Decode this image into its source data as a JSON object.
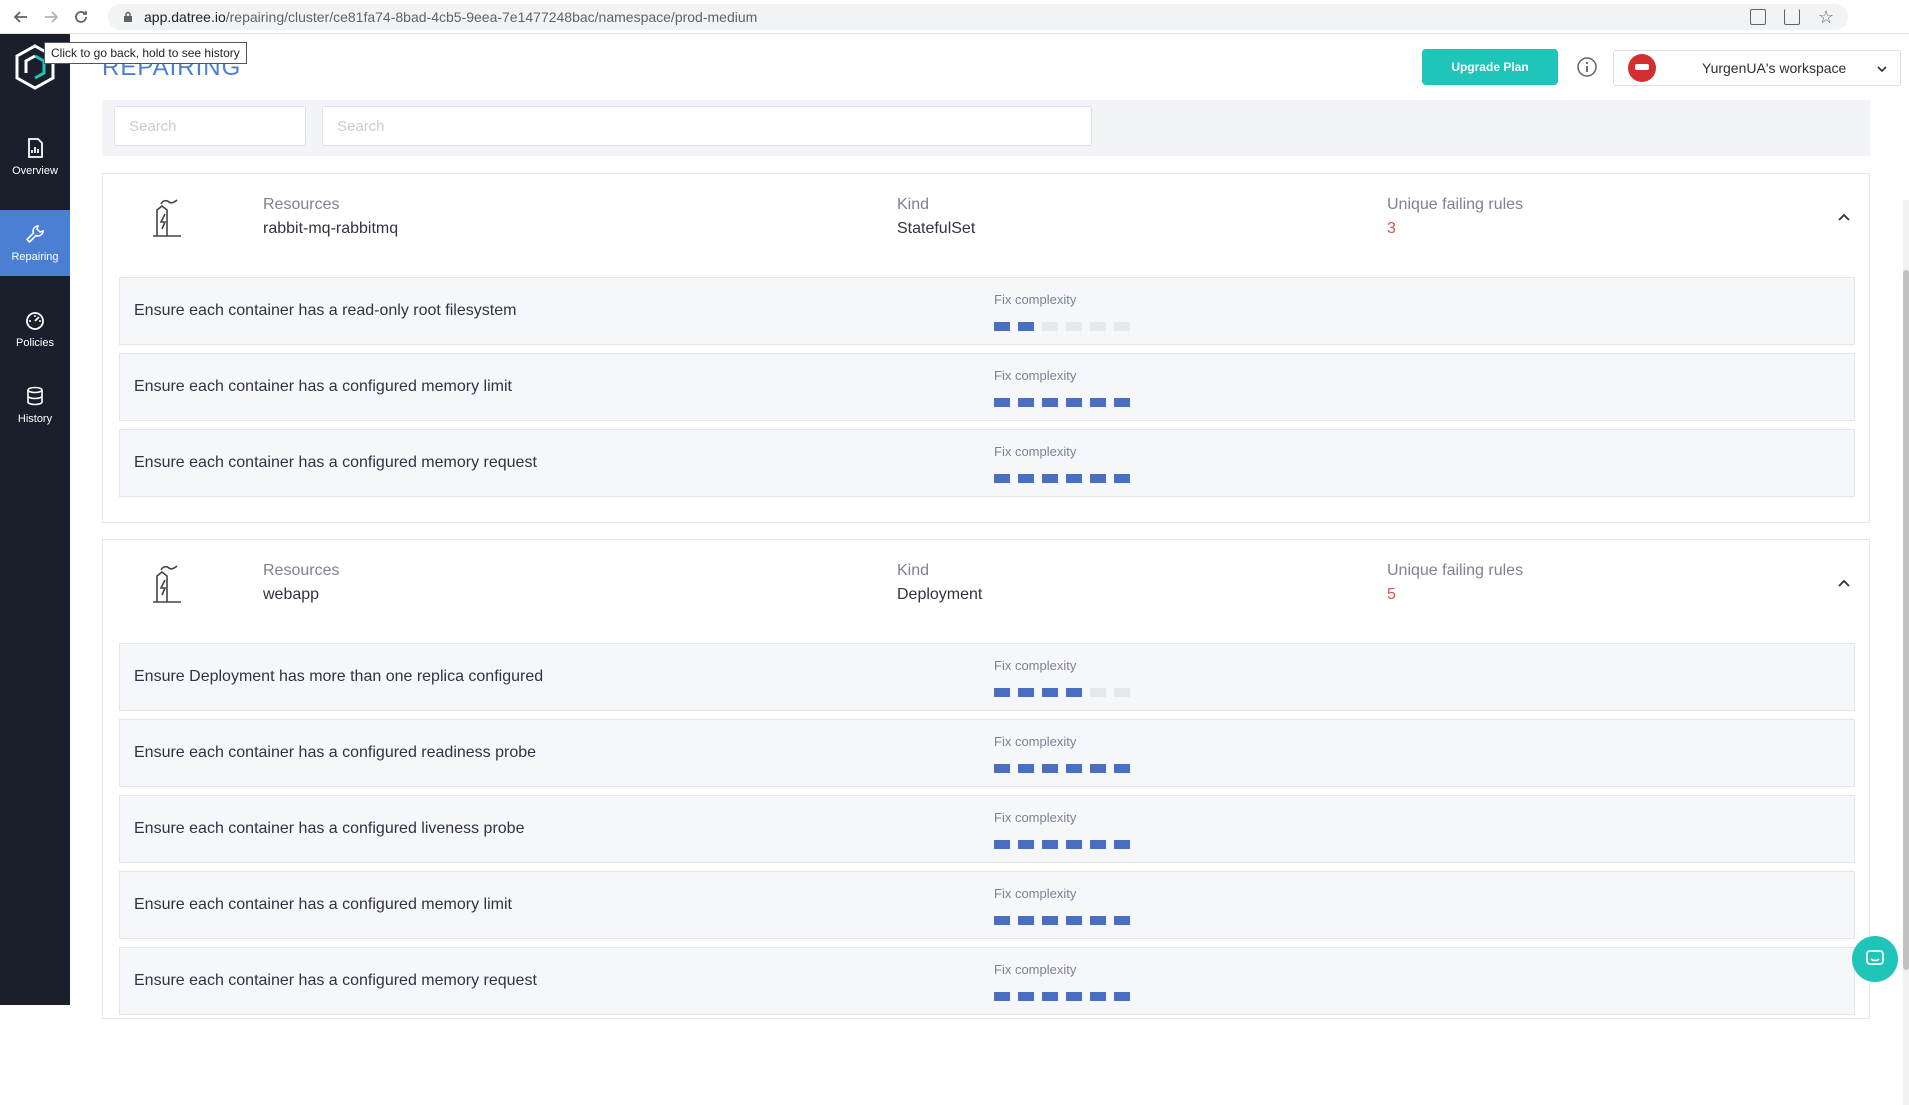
{
  "browser": {
    "url_host": "app.datree.io",
    "url_path": "/repairing/cluster/ce81fa74-8bad-4cb5-9eea-7e1477248bac/namespace/prod-medium",
    "tooltip": "Click to go back, hold to see history"
  },
  "sidebar": {
    "items": [
      {
        "label": "Overview",
        "icon": "overview-icon"
      },
      {
        "label": "Repairing",
        "icon": "wrench-icon"
      },
      {
        "label": "Policies",
        "icon": "gauge-icon"
      },
      {
        "label": "History",
        "icon": "database-icon"
      }
    ],
    "active_color": "#4a7fd4",
    "bg_color": "#1b1f2c"
  },
  "header": {
    "title": "REPAIRING",
    "upgrade_label": "Upgrade Plan",
    "workspace_name": "YurgenUA's workspace"
  },
  "filters": {
    "search1_placeholder": "Search",
    "search2_placeholder": "Search"
  },
  "labels": {
    "resources": "Resources",
    "kind": "Kind",
    "unique_failing_rules": "Unique failing rules",
    "fix_complexity": "Fix complexity"
  },
  "resources": [
    {
      "name": "rabbit-mq-rabbitmq",
      "kind": "StatefulSet",
      "unique_failing_rules": "3",
      "rules": [
        {
          "name": "Ensure each container has a read-only root filesystem",
          "complexity": 2
        },
        {
          "name": "Ensure each container has a configured memory limit",
          "complexity": 6
        },
        {
          "name": "Ensure each container has a configured memory request",
          "complexity": 6
        }
      ]
    },
    {
      "name": "webapp",
      "kind": "Deployment",
      "unique_failing_rules": "5",
      "rules": [
        {
          "name": "Ensure Deployment has more than one replica configured",
          "complexity": 4
        },
        {
          "name": "Ensure each container has a configured readiness probe",
          "complexity": 6
        },
        {
          "name": "Ensure each container has a configured liveness probe",
          "complexity": 6
        },
        {
          "name": "Ensure each container has a configured memory limit",
          "complexity": 6
        },
        {
          "name": "Ensure each container has a configured memory request",
          "complexity": 6
        }
      ]
    }
  ],
  "complexity_max": 6,
  "colors": {
    "accent": "#4a7fd4",
    "teal": "#1ec5b8",
    "bar_on": "#4a6fc1",
    "bar_off": "#e6e8ec",
    "failing_count": "#d9534f"
  }
}
